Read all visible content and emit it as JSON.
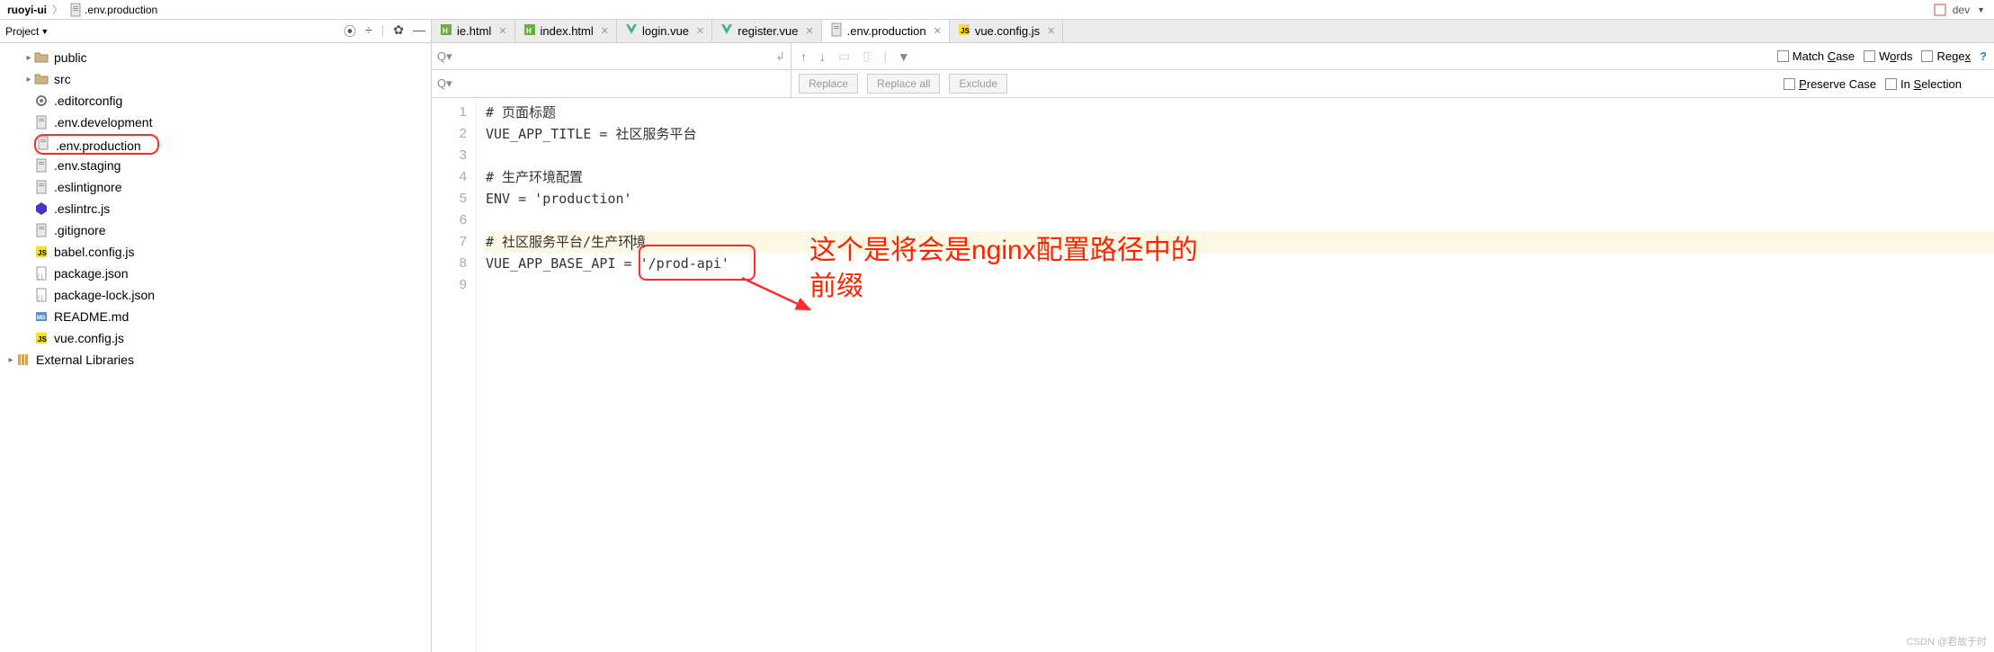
{
  "breadcrumb": {
    "project": "ruoyi-ui",
    "file": ".env.production",
    "config": "dev"
  },
  "sidebar": {
    "title": "Project",
    "items": [
      {
        "label": "public",
        "kind": "folder",
        "arrow": "▸"
      },
      {
        "label": "src",
        "kind": "folder",
        "arrow": "▸"
      },
      {
        "label": ".editorconfig",
        "kind": "gear"
      },
      {
        "label": ".env.development",
        "kind": "file"
      },
      {
        "label": ".env.production",
        "kind": "file",
        "hi": true
      },
      {
        "label": ".env.staging",
        "kind": "file"
      },
      {
        "label": ".eslintignore",
        "kind": "file"
      },
      {
        "label": ".eslintrc.js",
        "kind": "eslint"
      },
      {
        "label": ".gitignore",
        "kind": "file"
      },
      {
        "label": "babel.config.js",
        "kind": "js"
      },
      {
        "label": "package.json",
        "kind": "json"
      },
      {
        "label": "package-lock.json",
        "kind": "json"
      },
      {
        "label": "README.md",
        "kind": "md"
      },
      {
        "label": "vue.config.js",
        "kind": "js"
      }
    ],
    "external": "External Libraries"
  },
  "tabs": [
    {
      "label": "ie.html",
      "kind": "html"
    },
    {
      "label": "index.html",
      "kind": "html"
    },
    {
      "label": "login.vue",
      "kind": "vue"
    },
    {
      "label": "register.vue",
      "kind": "vue"
    },
    {
      "label": ".env.production",
      "kind": "file",
      "active": true
    },
    {
      "label": "vue.config.js",
      "kind": "js"
    }
  ],
  "find": {
    "search_ph": "",
    "replace_ph": "",
    "replace_btn": "Replace",
    "replace_all_btn": "Replace all",
    "exclude_btn": "Exclude",
    "match_case": "Match Case",
    "words": "Words",
    "regex": "Regex",
    "preserve": "Preserve Case",
    "in_sel": "In Selection"
  },
  "code": {
    "lines": [
      "# 页面标题",
      "VUE_APP_TITLE = 社区服务平台",
      "",
      "# 生产环境配置",
      "ENV = 'production'",
      "",
      "# 社区服务平台/生产环境",
      "VUE_APP_BASE_API = '/prod-api'",
      ""
    ]
  },
  "annotation": {
    "line1": "这个是将会是nginx配置路径中的",
    "line2": "前缀"
  },
  "watermark": "CSDN @君故于时"
}
